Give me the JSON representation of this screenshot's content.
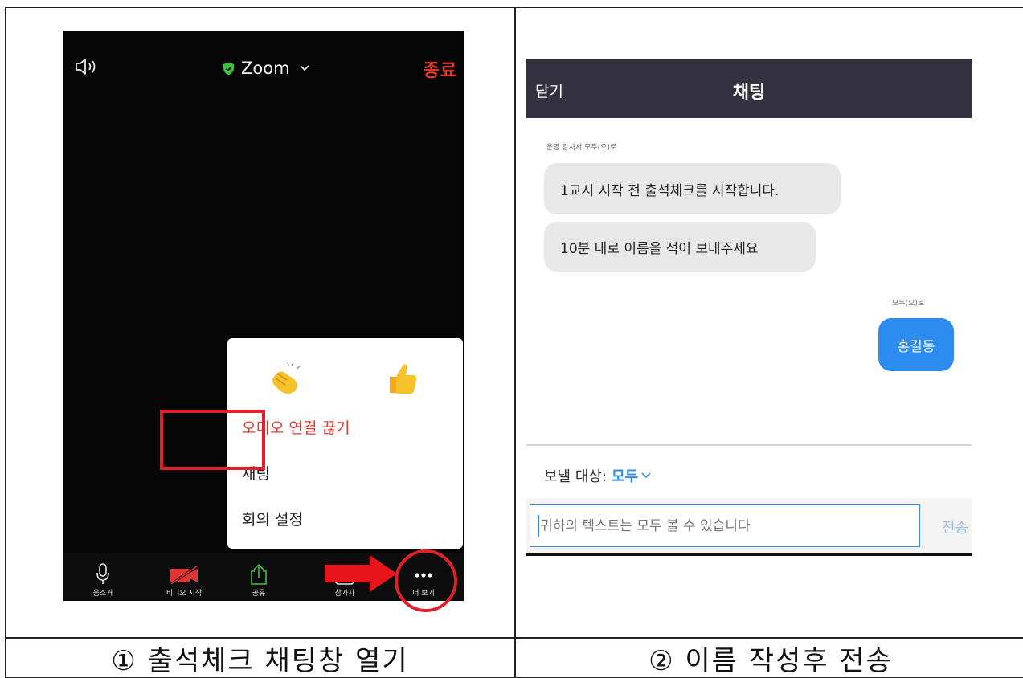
{
  "captions": {
    "left": "① 출석체크 채팅창 열기",
    "right": "② 이름 작성후 전송"
  },
  "zoom": {
    "title": "Zoom",
    "end_label": "종료",
    "reactions": [
      "clap",
      "thumbs-up"
    ],
    "menu": {
      "audio_disconnect": "오디오 연결 끊기",
      "chat": "채팅",
      "meeting_settings": "회의 설정"
    },
    "toolbar": {
      "mute": "음소거",
      "start_video": "비디오 시작",
      "share": "공유",
      "participants": "참가자",
      "more": "더 보기"
    },
    "colors": {
      "accent_red": "#e5382d",
      "highlight": "#e0202a",
      "shield": "#3fbf3f"
    }
  },
  "chat": {
    "close_label": "닫기",
    "title": "채팅",
    "sender_meta": "운영 강사서 모두(으)로",
    "messages": [
      "1교시 시작 전 출석체크를 시작합니다.",
      "10분 내로 이름을 적어 보내주세요"
    ],
    "recipient_meta": "모두(으)로",
    "my_message": "홍길동",
    "send_target_label": "보낼 대상:",
    "send_target_value": "모두",
    "input_placeholder": "귀하의 텍스트는 모두 볼 수 있습니다",
    "send_label": "전송",
    "colors": {
      "header_bg": "#33313f",
      "accent_blue": "#2d8cf0"
    }
  }
}
